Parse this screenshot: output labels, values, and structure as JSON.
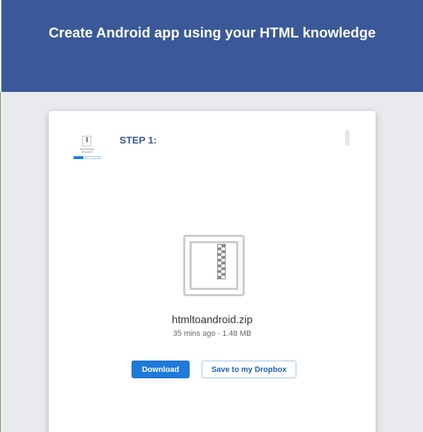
{
  "header": {
    "title": "Create Android app using your HTML knowledge"
  },
  "step": {
    "label": "STEP 1:"
  },
  "file": {
    "name": "htmltoandroid.zip",
    "meta": "35 mins ago · 1.48 MB",
    "icon": "zip-file-icon"
  },
  "actions": {
    "download_label": "Download",
    "dropbox_label": "Save to my Dropbox"
  },
  "colors": {
    "header_bg": "#3b5998",
    "primary": "#1f7ad9",
    "page_bg": "#e9eaee"
  }
}
